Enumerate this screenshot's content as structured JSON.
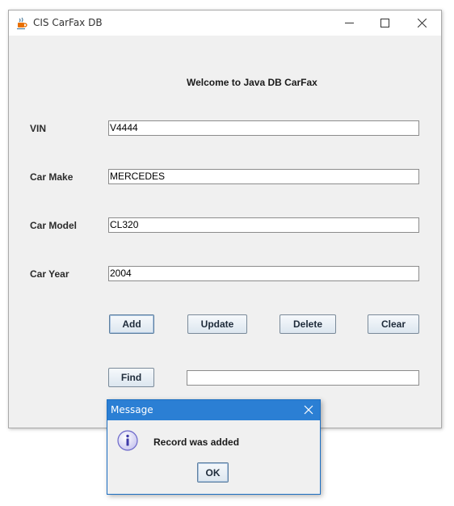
{
  "window": {
    "title": "CIS CarFax DB"
  },
  "form": {
    "welcome": "Welcome to Java DB CarFax",
    "fields": [
      {
        "label": "VIN",
        "value": "V4444"
      },
      {
        "label": "Car Make",
        "value": "MERCEDES"
      },
      {
        "label": "Car Model",
        "value": "CL320"
      },
      {
        "label": "Car Year",
        "value": "2004"
      }
    ],
    "buttons": {
      "add": "Add",
      "update": "Update",
      "delete": "Delete",
      "clear": "Clear",
      "find": "Find"
    },
    "find_value": ""
  },
  "dialog": {
    "title": "Message",
    "message": "Record was added",
    "ok": "OK"
  },
  "colors": {
    "dialog_titlebar": "#2b7fd4",
    "window_bg": "#f0f0f0",
    "button_gradient_bottom": "#dce6ef"
  },
  "icons": {
    "app": "java-coffee-cup-icon",
    "minimize": "minimize-icon",
    "maximize": "maximize-icon",
    "close": "close-icon",
    "info": "information-icon"
  }
}
